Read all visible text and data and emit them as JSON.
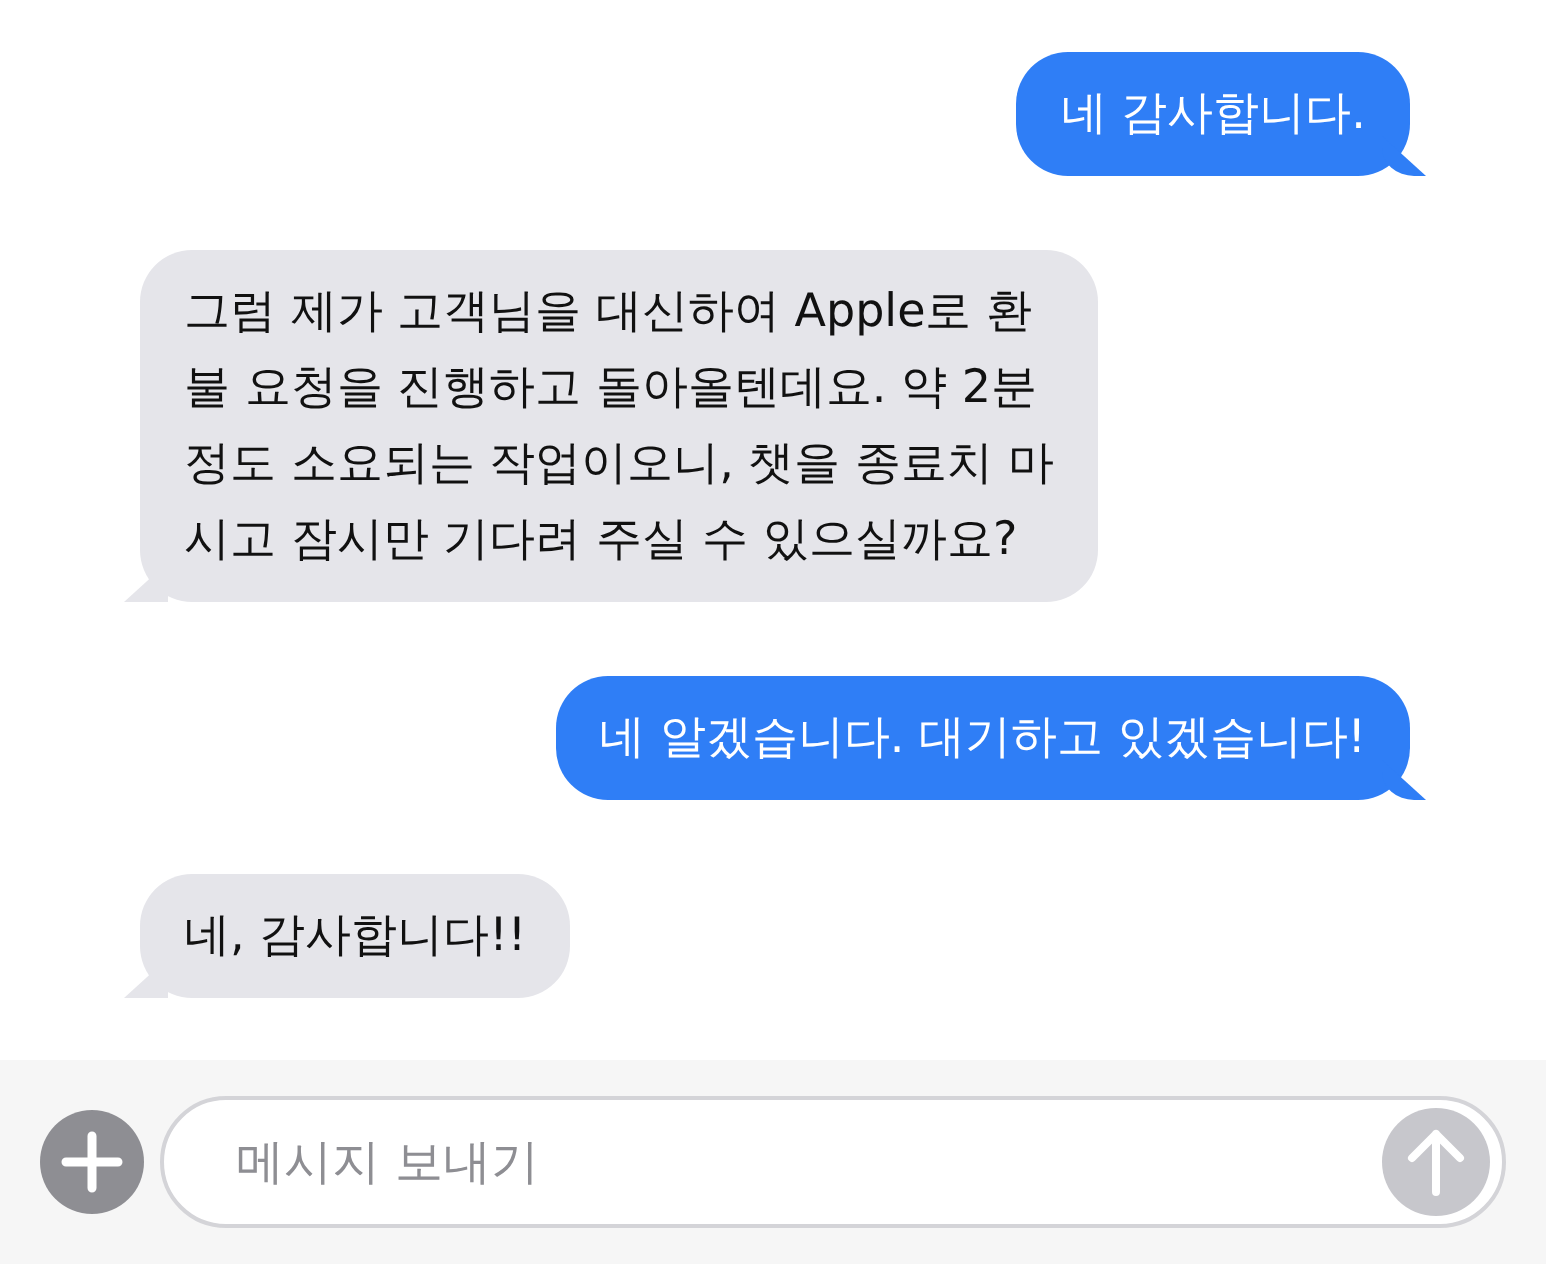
{
  "messages": [
    {
      "kind": "sent",
      "text": "네 감사합니다."
    },
    {
      "kind": "received",
      "text": "그럼 제가 고객님을 대신하여 Apple로 환\n불 요청을 진행하고 돌아올텐데요. 약 2분\n정도 소요되는 작업이오니, 챗을 종료치 마\n시고 잠시만 기다려 주실 수 있으실까요?"
    },
    {
      "kind": "sent",
      "text": "네 알겠습니다. 대기하고 있겠습니다!"
    },
    {
      "kind": "received",
      "text": "네, 감사합니다!!"
    }
  ],
  "composer": {
    "placeholder": "메시지 보내기"
  }
}
